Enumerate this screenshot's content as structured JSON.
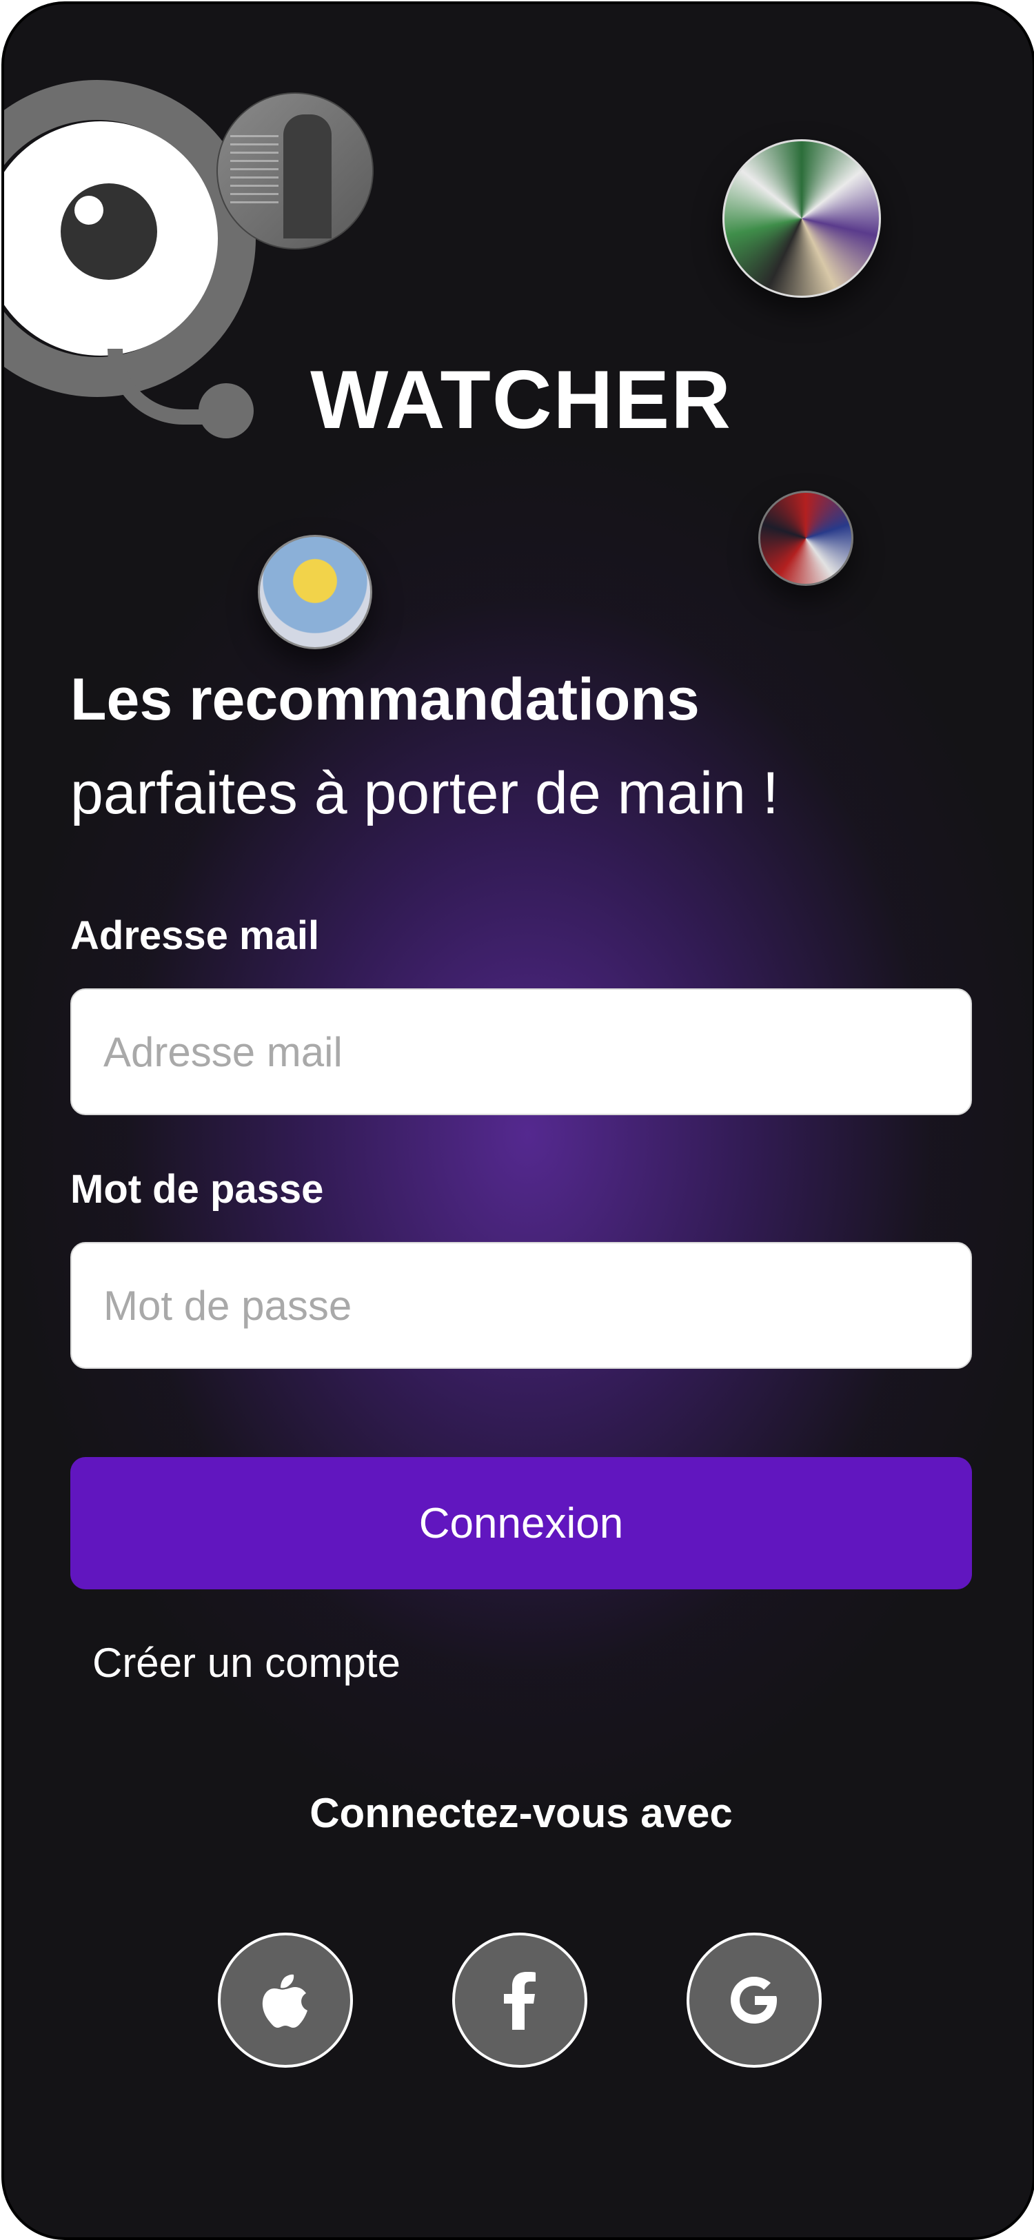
{
  "app": {
    "name": "WATCHER"
  },
  "hero": {
    "title_bold": "Les recommandations",
    "title_light": "parfaites à porter de main !"
  },
  "form": {
    "email_label": "Adresse mail",
    "email_placeholder": "Adresse mail",
    "password_label": "Mot de passe",
    "password_placeholder": "Mot de passe",
    "submit_label": "Connexion",
    "create_account_label": "Créer un compte"
  },
  "social": {
    "heading": "Connectez-vous avec",
    "providers": [
      {
        "icon": "apple-icon"
      },
      {
        "icon": "facebook-icon"
      },
      {
        "icon": "google-icon"
      }
    ]
  },
  "colors": {
    "background": "#141316",
    "accent_glow": "#582a96",
    "button": "#6116bf",
    "social_circle": "#606060"
  }
}
